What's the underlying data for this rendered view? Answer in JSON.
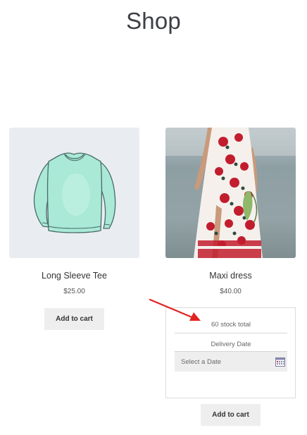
{
  "page": {
    "title": "Shop"
  },
  "products": [
    {
      "name": "Long Sleeve Tee",
      "price": "$25.00",
      "button_label": "Add to cart",
      "image_icon": "long-sleeve-tee-illustration"
    },
    {
      "name": "Maxi dress",
      "price": "$40.00",
      "button_label": "Add to cart",
      "image_icon": "maxi-dress-photo",
      "booking": {
        "stock_text": "60 stock total",
        "delivery_label": "Delivery Date",
        "date_placeholder": "Select a Date",
        "date_icon": "calendar-icon"
      }
    }
  ],
  "annotation": {
    "arrow_color": "#e32222"
  }
}
